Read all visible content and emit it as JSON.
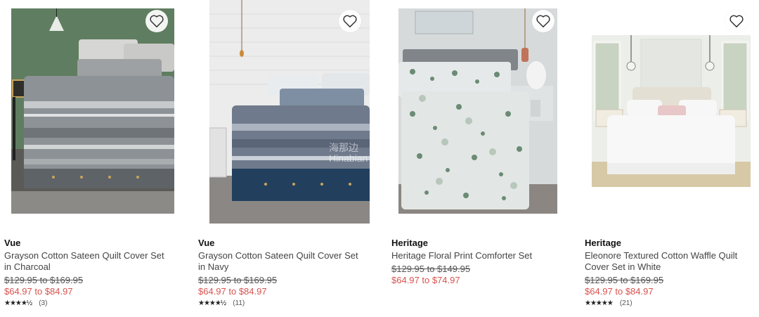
{
  "products": [
    {
      "brand": "Vue",
      "title_line1": "Grayson Cotton Sateen Quilt Cover Set",
      "title_line2": "in Charcoal",
      "was_price": "$129.95 to $169.95",
      "now_price": "$64.97 to $84.97",
      "stars": "★★★★½",
      "rating_value": 4.5,
      "review_count": "(3)",
      "image_icon": "bedroom-charcoal-quilt-image",
      "wishlist_icon": "heart-outline-icon"
    },
    {
      "brand": "Vue",
      "title_line1": "Grayson Cotton Sateen Quilt Cover Set",
      "title_line2": "in Navy",
      "was_price": "$129.95 to $169.95",
      "now_price": "$64.97 to $84.97",
      "stars": "★★★★½",
      "rating_value": 4.5,
      "review_count": "(11)",
      "image_icon": "bedroom-navy-quilt-image",
      "wishlist_icon": "heart-outline-icon"
    },
    {
      "brand": "Heritage",
      "title_line1": "Heritage Floral Print Comforter Set",
      "title_line2": "",
      "was_price": "$129.95 to $149.95",
      "now_price": "$64.97 to $74.97",
      "stars": "",
      "rating_value": null,
      "review_count": "",
      "image_icon": "bedroom-floral-comforter-image",
      "wishlist_icon": "heart-outline-icon"
    },
    {
      "brand": "Heritage",
      "title_line1": "Eleonore Textured Cotton Waffle Quilt",
      "title_line2": "Cover Set in White",
      "was_price": "$129.95 to $169.95",
      "now_price": "$64.97 to $84.97",
      "stars": "★★★★★",
      "rating_value": 5,
      "review_count": "(21)",
      "image_icon": "bedroom-white-waffle-quilt-image",
      "wishlist_icon": "heart-outline-icon"
    }
  ],
  "watermark": {
    "line1": "海那边",
    "line2": "Hinabian"
  },
  "colors": {
    "sale_price": "#d9534f",
    "brand_text": "#111111",
    "strike_text": "#555555"
  }
}
